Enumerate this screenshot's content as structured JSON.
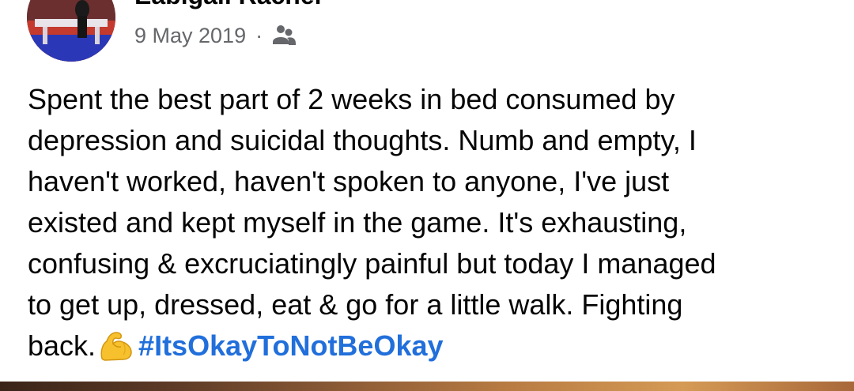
{
  "post": {
    "author": "Eabigail Rachel",
    "date": "9 May 2019",
    "separator": "·",
    "audience_icon": "friends-icon",
    "lines": [
      "Spent the best part of 2 weeks in bed consumed by",
      "depression and suicidal thoughts. Numb and empty, I",
      "haven't worked, haven't spoken to anyone, I've just",
      "existed and kept myself in the game. It's exhausting,",
      "confusing & excruciatingly painful but today I managed",
      "to get up, dressed, eat & go for a little walk. Fighting",
      "back."
    ],
    "emoji": "flexed-biceps-icon",
    "hashtag": "#ItsOkayToNotBeOkay"
  },
  "colors": {
    "text": "#050505",
    "meta": "#65676b",
    "hashtag": "#216fdb",
    "background": "#ffffff"
  }
}
